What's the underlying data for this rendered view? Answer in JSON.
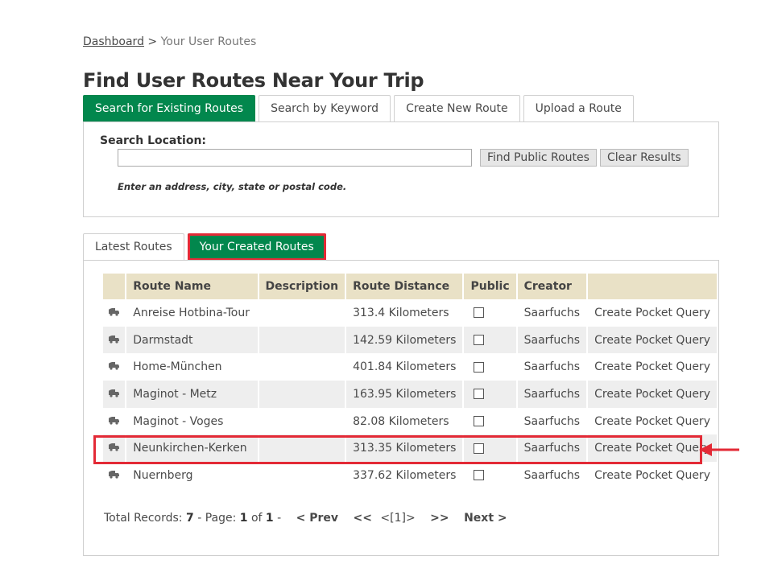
{
  "breadcrumb": {
    "link": "Dashboard",
    "separator": ">",
    "current": "Your User Routes"
  },
  "page_title": "Find User Routes Near Your Trip",
  "top_tabs": [
    "Search for Existing Routes",
    "Search by Keyword",
    "Create New Route",
    "Upload a Route"
  ],
  "search": {
    "label": "Search Location:",
    "value": "",
    "find_button": "Find Public Routes",
    "clear_button": "Clear Results",
    "hint": "Enter an address, city, state or postal code."
  },
  "route_tabs": [
    "Latest Routes",
    "Your Created Routes"
  ],
  "table": {
    "headers": [
      "",
      "Route Name",
      "Description",
      "Route Distance",
      "Public",
      "Creator",
      ""
    ],
    "rows": [
      {
        "name": "Anreise Hotbina-Tour",
        "description": "",
        "distance": "313.4 Kilometers",
        "creator": "Saarfuchs",
        "action": "Create Pocket Query"
      },
      {
        "name": "Darmstadt",
        "description": "",
        "distance": "142.59 Kilometers",
        "creator": "Saarfuchs",
        "action": "Create Pocket Query"
      },
      {
        "name": "Home-München",
        "description": "",
        "distance": "401.84 Kilometers",
        "creator": "Saarfuchs",
        "action": "Create Pocket Query"
      },
      {
        "name": "Maginot - Metz",
        "description": "",
        "distance": "163.95 Kilometers",
        "creator": "Saarfuchs",
        "action": "Create Pocket Query"
      },
      {
        "name": "Maginot - Voges",
        "description": "",
        "distance": "82.08 Kilometers",
        "creator": "Saarfuchs",
        "action": "Create Pocket Query"
      },
      {
        "name": "Neunkirchen-Kerken",
        "description": "",
        "distance": "313.35 Kilometers",
        "creator": "Saarfuchs",
        "action": "Create Pocket Query"
      },
      {
        "name": "Nuernberg",
        "description": "",
        "distance": "337.62 Kilometers",
        "creator": "Saarfuchs",
        "action": "Create Pocket Query"
      }
    ]
  },
  "pager": {
    "total_label": "Total Records:",
    "total": "7",
    "page_label": "- Page:",
    "page": "1",
    "of_label": "of",
    "pages": "1",
    "dash": "-",
    "prev": "< Prev",
    "first": "<<",
    "current": "<[1]>",
    "last": ">>",
    "next": "Next >"
  },
  "icons": {
    "row_icon": "car-icon",
    "annotation": "red-arrow-icon"
  },
  "colors": {
    "accent": "#02874D",
    "header_bg": "#e9e1c6",
    "highlight": "#e32a36"
  }
}
